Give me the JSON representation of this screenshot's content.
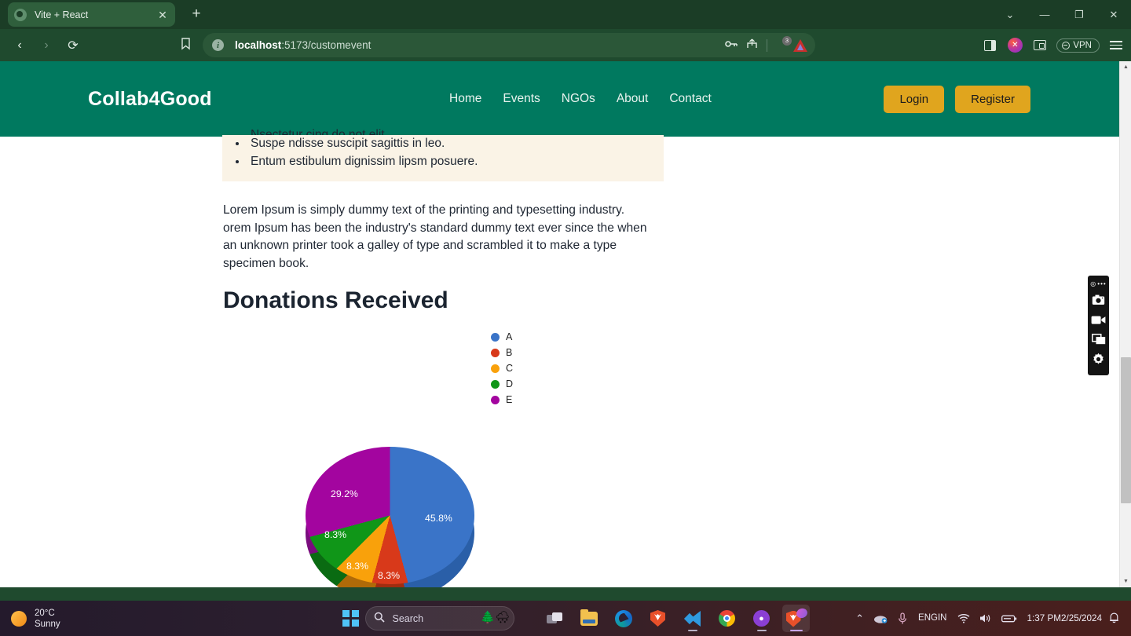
{
  "browser": {
    "tab": {
      "title": "Vite + React",
      "favicon": "vite-react-favicon",
      "close_label": "✕"
    },
    "new_tab_label": "+",
    "window_controls": {
      "more": "⌄",
      "minimize": "—",
      "maximize": "❐",
      "close": "✕"
    },
    "nav": {
      "back": "‹",
      "forward": "›",
      "reload": "⟳",
      "bookmark": "🔖"
    },
    "omnibox": {
      "info_icon": "i",
      "url_host": "localhost",
      "url_path": ":5173/customevent",
      "password_icon": "key-icon",
      "share_icon": "share-icon",
      "shield_badge": "3"
    },
    "toolbar": {
      "vpn_label": "VPN"
    }
  },
  "site": {
    "brand": "Collab4Good",
    "nav_items": [
      "Home",
      "Events",
      "NGOs",
      "About",
      "Contact"
    ],
    "login_label": "Login",
    "register_label": "Register",
    "brand_color": "#00795f",
    "accent_color": "#e0a51e"
  },
  "page": {
    "bullets": [
      "Nsectetur cing do not elit.",
      "Suspe ndisse suscipit sagittis in leo.",
      "Entum estibulum dignissim lipsm posuere."
    ],
    "paragraph": "Lorem Ipsum is simply dummy text of the printing and typesetting industry. orem Ipsum has been the industry's standard dummy text ever since the when an unknown printer took a galley of type and scrambled it to make a type specimen book.",
    "section_title": "Donations Received"
  },
  "chart_data": {
    "type": "pie",
    "title": "Donations Received",
    "categories": [
      "A",
      "B",
      "C",
      "D",
      "E"
    ],
    "values": [
      45.8,
      8.3,
      8.3,
      8.3,
      29.2
    ],
    "labels": [
      "45.8%",
      "8.3%",
      "8.3%",
      "8.3%",
      "29.2%"
    ],
    "colors": [
      "#3a74c8",
      "#d8391a",
      "#f9a10b",
      "#109618",
      "#a3059f"
    ],
    "side_colors": [
      "#2a5fa8",
      "#a02d10",
      "#b06a08",
      "#0a6b12",
      "#7a0d7e"
    ],
    "legend_position": "right",
    "is_3d": true,
    "start_angle_deg": 0,
    "xlabel": "",
    "ylabel": ""
  },
  "recorder": {
    "menu_dots": "•••",
    "camera": "camera-icon",
    "video": "video-icon",
    "window": "window-icon",
    "settings": "gear-icon"
  },
  "taskbar": {
    "weather": {
      "temp": "20°C",
      "condition": "Sunny"
    },
    "search_placeholder": "Search",
    "apps": [
      "task-view",
      "file-explorer",
      "microsoft-edge",
      "brave-browser",
      "vs-code",
      "google-chrome",
      "github-desktop",
      "brave-browser-active"
    ],
    "tray": {
      "overflow": "⌃",
      "language_line1": "ENG",
      "language_line2": "IN",
      "time": "1:37 PM",
      "date": "2/25/2024"
    }
  }
}
